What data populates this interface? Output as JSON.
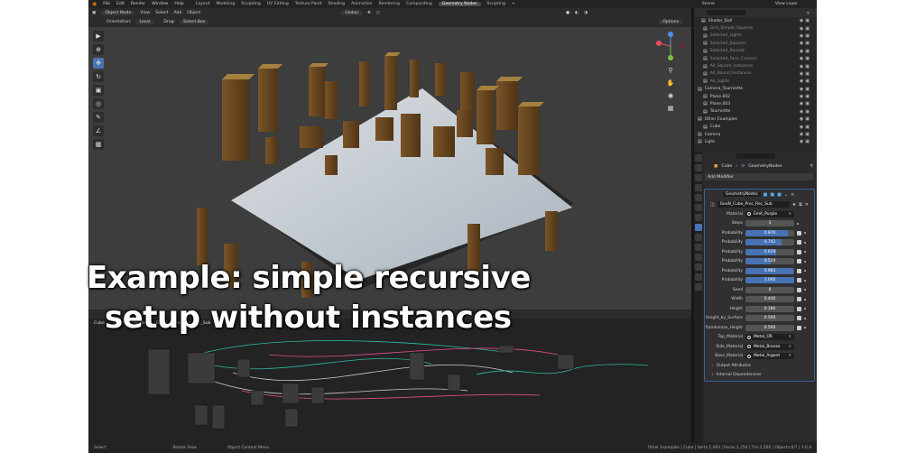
{
  "menu": {
    "items": [
      "File",
      "Edit",
      "Render",
      "Window",
      "Help"
    ],
    "workspaces": [
      "Layout",
      "Modeling",
      "Sculpting",
      "UV Editing",
      "Texture Paint",
      "Shading",
      "Animation",
      "Rendering",
      "Compositing",
      "Geometry Nodes",
      "Scripting"
    ],
    "active_workspace": "Geometry Nodes",
    "scene_label": "Scene",
    "view_layer_label": "View Layer"
  },
  "viewport": {
    "mode": "Object Mode",
    "menus": [
      "View",
      "Select",
      "Add",
      "Object"
    ],
    "transform": "Global",
    "orientation_label": "Orientation:",
    "orientation_value": "Local",
    "drag_label": "Drag:",
    "drag_value": "Select Box",
    "options_label": "Options"
  },
  "node_editor": {
    "breadcrumb": [
      "Cube",
      "GeometryNodes",
      "GeoN_Cube_Proc_Rec_Sub"
    ]
  },
  "outliner": {
    "rows": [
      {
        "label": "Shader_Ball",
        "dim": false
      },
      {
        "label": "Grid_Simple_Squares",
        "dim": true
      },
      {
        "label": "Selected_Lights",
        "dim": true
      },
      {
        "label": "Selected_Squares",
        "dim": true
      },
      {
        "label": "Selected_Rounds",
        "dim": true
      },
      {
        "label": "Selected_Face_Corners",
        "dim": true
      },
      {
        "label": "All_Square_Instances",
        "dim": true
      },
      {
        "label": "All_Round_Instances",
        "dim": true
      },
      {
        "label": "All_Lights",
        "dim": true
      },
      {
        "label": "Camera_Tourniette",
        "dim": false
      },
      {
        "label": "Plane.002",
        "dim": false
      },
      {
        "label": "Plane.003",
        "dim": false
      },
      {
        "label": "Tourniette",
        "dim": false
      },
      {
        "label": "Other Examples",
        "dim": false
      },
      {
        "label": "Cube",
        "dim": false
      },
      {
        "label": "Camera",
        "dim": false
      },
      {
        "label": "Light",
        "dim": false
      }
    ]
  },
  "properties": {
    "breadcrumb_object": "Cube",
    "breadcrumb_modifier": "GeometryNodes",
    "add_modifier": "Add Modifier",
    "modifier_name": "GeometryNodes",
    "node_group": "GeoN_Cube_Proc_Rec_Sub",
    "material": {
      "label": "Material",
      "value": "Emit_Purple"
    },
    "steps": {
      "label": "Steps",
      "value": "3"
    },
    "probabilities": [
      {
        "label": "Probability",
        "value": "0.870",
        "fraction": 0.87
      },
      {
        "label": "Probability",
        "value": "0.742",
        "fraction": 0.742
      },
      {
        "label": "Probability",
        "value": "0.629",
        "fraction": 0.629
      },
      {
        "label": "Probability",
        "value": "0.524",
        "fraction": 0.524
      },
      {
        "label": "Probability",
        "value": "0.983",
        "fraction": 0.983
      },
      {
        "label": "Probability",
        "value": "1.000",
        "fraction": 1.0
      }
    ],
    "fields": [
      {
        "label": "Seed",
        "value": "0"
      },
      {
        "label": "Width",
        "value": "0.440"
      },
      {
        "label": "Height",
        "value": "0.180"
      },
      {
        "label": "Height_by_Surface",
        "value": "0.500"
      },
      {
        "label": "Randomize_Height",
        "value": "0.500"
      }
    ],
    "materials": [
      {
        "label": "Top_Material",
        "value": "Metal_OR"
      },
      {
        "label": "Side_Material",
        "value": "Metal_Bronze"
      },
      {
        "label": "Base_Material",
        "value": "Metal_Argent"
      }
    ],
    "output_attributes": "Output Attributes",
    "internal_dependencies": "Internal Dependencies"
  },
  "status_bar": {
    "select": "Select",
    "rotate": "Rotate View",
    "context": "Object Context Menu",
    "stats": "Other Examples | Cube | Verts:1,493 | Faces:1,254 | Tris:2,500 | Objects:0/7 | 3.6.4"
  },
  "caption": {
    "line1": "Example: simple recursive",
    "line2": "setup without instances"
  },
  "colors": {
    "accent": "#4772b3",
    "active_outline": "#3c5f92",
    "box_top": "#d8e0e8",
    "box_side": "#6b4a22"
  }
}
